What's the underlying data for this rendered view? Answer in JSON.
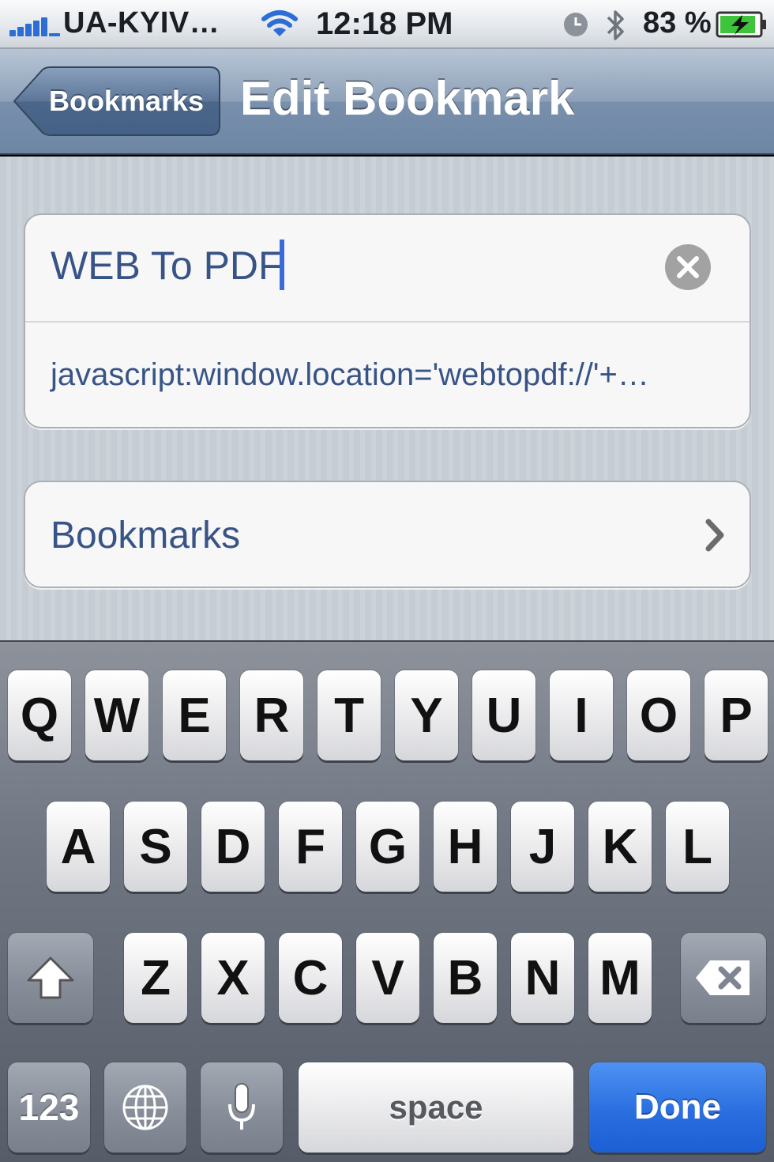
{
  "status_bar": {
    "carrier": "UA-KYIV…",
    "time": "12:18 PM",
    "battery_percent": "83 %",
    "icons": [
      "signal-icon",
      "wifi-icon",
      "alarm-icon",
      "bluetooth-icon",
      "battery-charging-icon"
    ]
  },
  "nav": {
    "back_label": "Bookmarks",
    "title": "Edit Bookmark"
  },
  "form": {
    "bookmark_title": "WEB To PDF",
    "bookmark_url": "javascript:window.location='webtopdf://'+…",
    "folder_label": "Bookmarks"
  },
  "keyboard": {
    "row1": [
      "Q",
      "W",
      "E",
      "R",
      "T",
      "Y",
      "U",
      "I",
      "O",
      "P"
    ],
    "row2": [
      "A",
      "S",
      "D",
      "F",
      "G",
      "H",
      "J",
      "K",
      "L"
    ],
    "row3": [
      "Z",
      "X",
      "C",
      "V",
      "B",
      "N",
      "M"
    ],
    "numbers_label": "123",
    "space_label": "space",
    "done_label": "Done"
  },
  "colors": {
    "accent_blue": "#2a6ee0",
    "field_text": "#385487",
    "cursor": "#3a6bd8"
  }
}
